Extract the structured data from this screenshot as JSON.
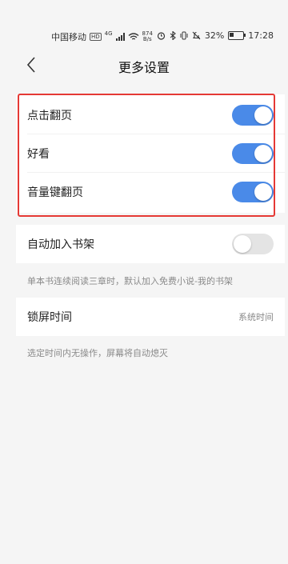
{
  "status_bar": {
    "carrier": "中国移动",
    "hd": "HD",
    "net": "4G",
    "speed_top": "874",
    "speed_bottom": "B/s",
    "battery": "32%",
    "battery_level": 0.32,
    "time": "17:28",
    "icons": [
      "alarm-icon",
      "bluetooth-icon",
      "vibrate-icon",
      "mute-icon",
      "battery-icon"
    ]
  },
  "header": {
    "title": "更多设置",
    "back_icon": "chevron-left-icon"
  },
  "highlighted_settings": [
    {
      "label": "点击翻页",
      "enabled": true
    },
    {
      "label": "好看",
      "enabled": true
    },
    {
      "label": "音量键翻页",
      "enabled": true
    }
  ],
  "auto_shelf": {
    "label": "自动加入书架",
    "enabled": false,
    "note": "单本书连续阅读三章时，默认加入免费小说-我的书架"
  },
  "lock_screen": {
    "label": "锁屏时间",
    "value": "系统时间",
    "note": "选定时间内无操作，屏幕将自动熄灭"
  },
  "colors": {
    "accent": "#4a8ae8",
    "toggle_off": "#e4e4e4",
    "highlight_border": "#e53935",
    "background": "#f5f5f5"
  }
}
